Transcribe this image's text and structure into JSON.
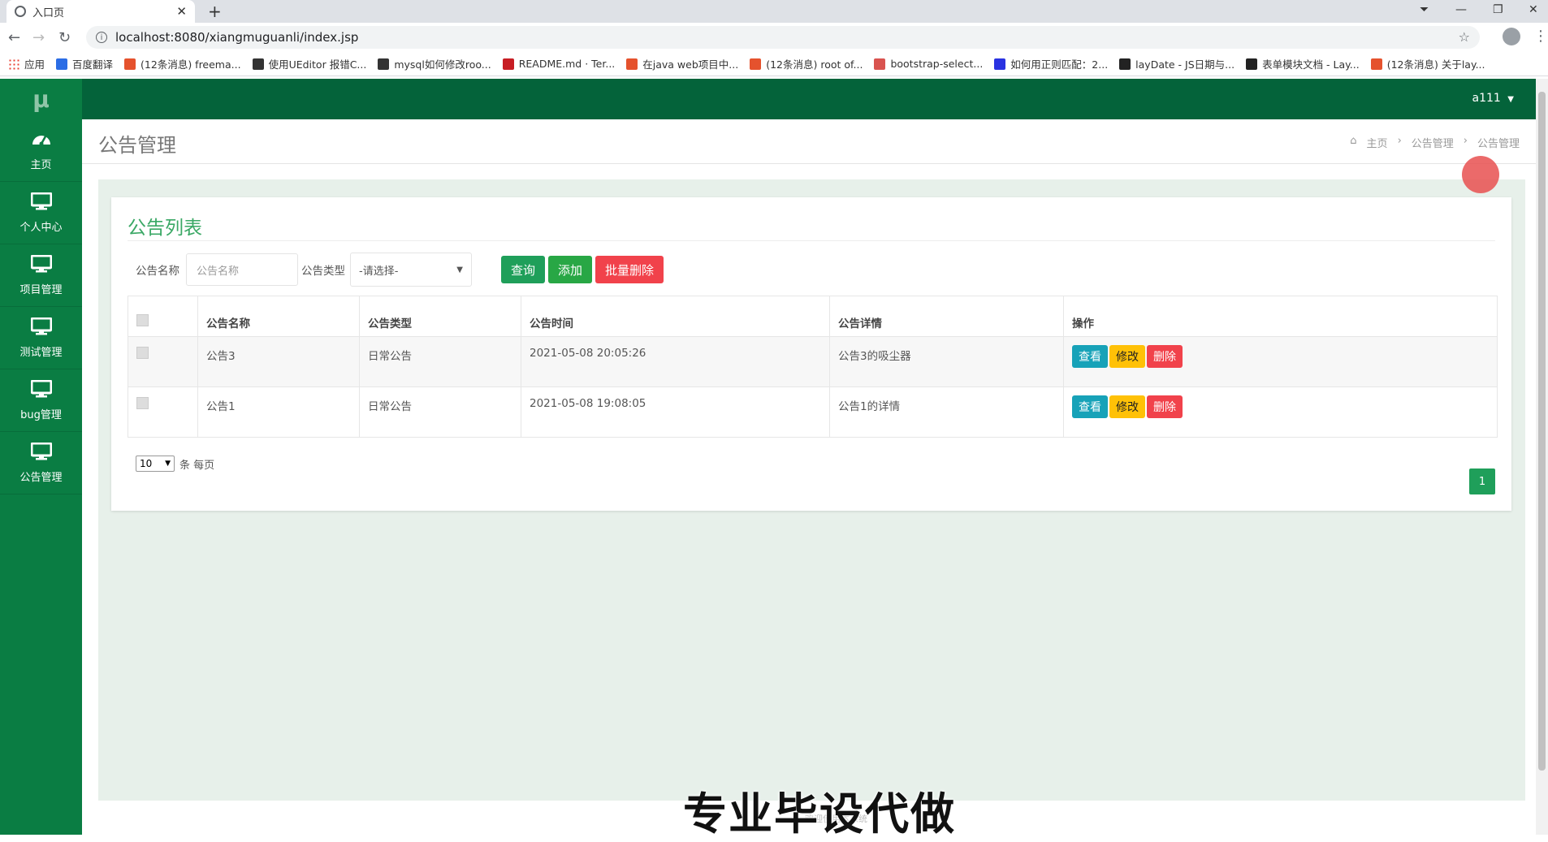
{
  "browser": {
    "tab_title": "入口页",
    "url": "localhost:8080/xiangmuguanli/index.jsp",
    "bookmarks": [
      {
        "label": "应用",
        "color": "#e94235"
      },
      {
        "label": "百度翻译",
        "color": "#2b6de5"
      },
      {
        "label": "(12条消息) freema...",
        "color": "#e5522d"
      },
      {
        "label": "使用UEditor 报错C...",
        "color": "#333333"
      },
      {
        "label": "mysql如何修改roo...",
        "color": "#333333"
      },
      {
        "label": "README.md · Ter...",
        "color": "#c71d23"
      },
      {
        "label": "在java web项目中...",
        "color": "#e5522d"
      },
      {
        "label": "(12条消息) root of...",
        "color": "#e5522d"
      },
      {
        "label": "bootstrap-select...",
        "color": "#d9534f"
      },
      {
        "label": "如何用正则匹配：2...",
        "color": "#2932e1"
      },
      {
        "label": "layDate - JS日期与...",
        "color": "#222222"
      },
      {
        "label": "表单模块文档 - Lay...",
        "color": "#222222"
      },
      {
        "label": "(12条消息) 关于lay...",
        "color": "#e5522d"
      }
    ]
  },
  "sidebar": {
    "logo": "μ",
    "items": [
      {
        "label": "主页",
        "icon": "dashboard-icon"
      },
      {
        "label": "个人中心",
        "icon": "monitor-icon"
      },
      {
        "label": "项目管理",
        "icon": "monitor-icon"
      },
      {
        "label": "测试管理",
        "icon": "monitor-icon"
      },
      {
        "label": "bug管理",
        "icon": "monitor-icon"
      },
      {
        "label": "公告管理",
        "icon": "monitor-icon"
      }
    ]
  },
  "topnav": {
    "user": "a111"
  },
  "header": {
    "title": "公告管理",
    "breadcrumb": [
      "主页",
      "公告管理",
      "公告管理"
    ]
  },
  "panel": {
    "title": "公告列表",
    "search": {
      "name_label": "公告名称",
      "name_placeholder": "公告名称",
      "type_label": "公告类型",
      "type_selected": "-请选择-",
      "query_button": "查询",
      "add_button": "添加",
      "batch_delete_button": "批量删除"
    },
    "table": {
      "headers": [
        "公告名称",
        "公告类型",
        "公告时间",
        "公告详情",
        "操作"
      ],
      "rows": [
        {
          "name": "公告3",
          "type": "日常公告",
          "time": "2021-05-08 20:05:26",
          "detail": "公告3的吸尘器"
        },
        {
          "name": "公告1",
          "type": "日常公告",
          "time": "2021-05-08 19:08:05",
          "detail": "公告1的详情"
        }
      ],
      "actions": {
        "view": "查看",
        "edit": "修改",
        "delete": "删除"
      }
    },
    "pagination": {
      "per_page": "10",
      "per_page_suffix": "条 每页",
      "current_page": "1"
    }
  },
  "footer": {
    "text": "欢迎使用本系统"
  },
  "watermark": "专业毕设代做",
  "colors": {
    "sidebar": "#0a7d43",
    "topnav": "#04633a",
    "accent": "#3aa865",
    "content_bg": "#e7f0ea"
  }
}
